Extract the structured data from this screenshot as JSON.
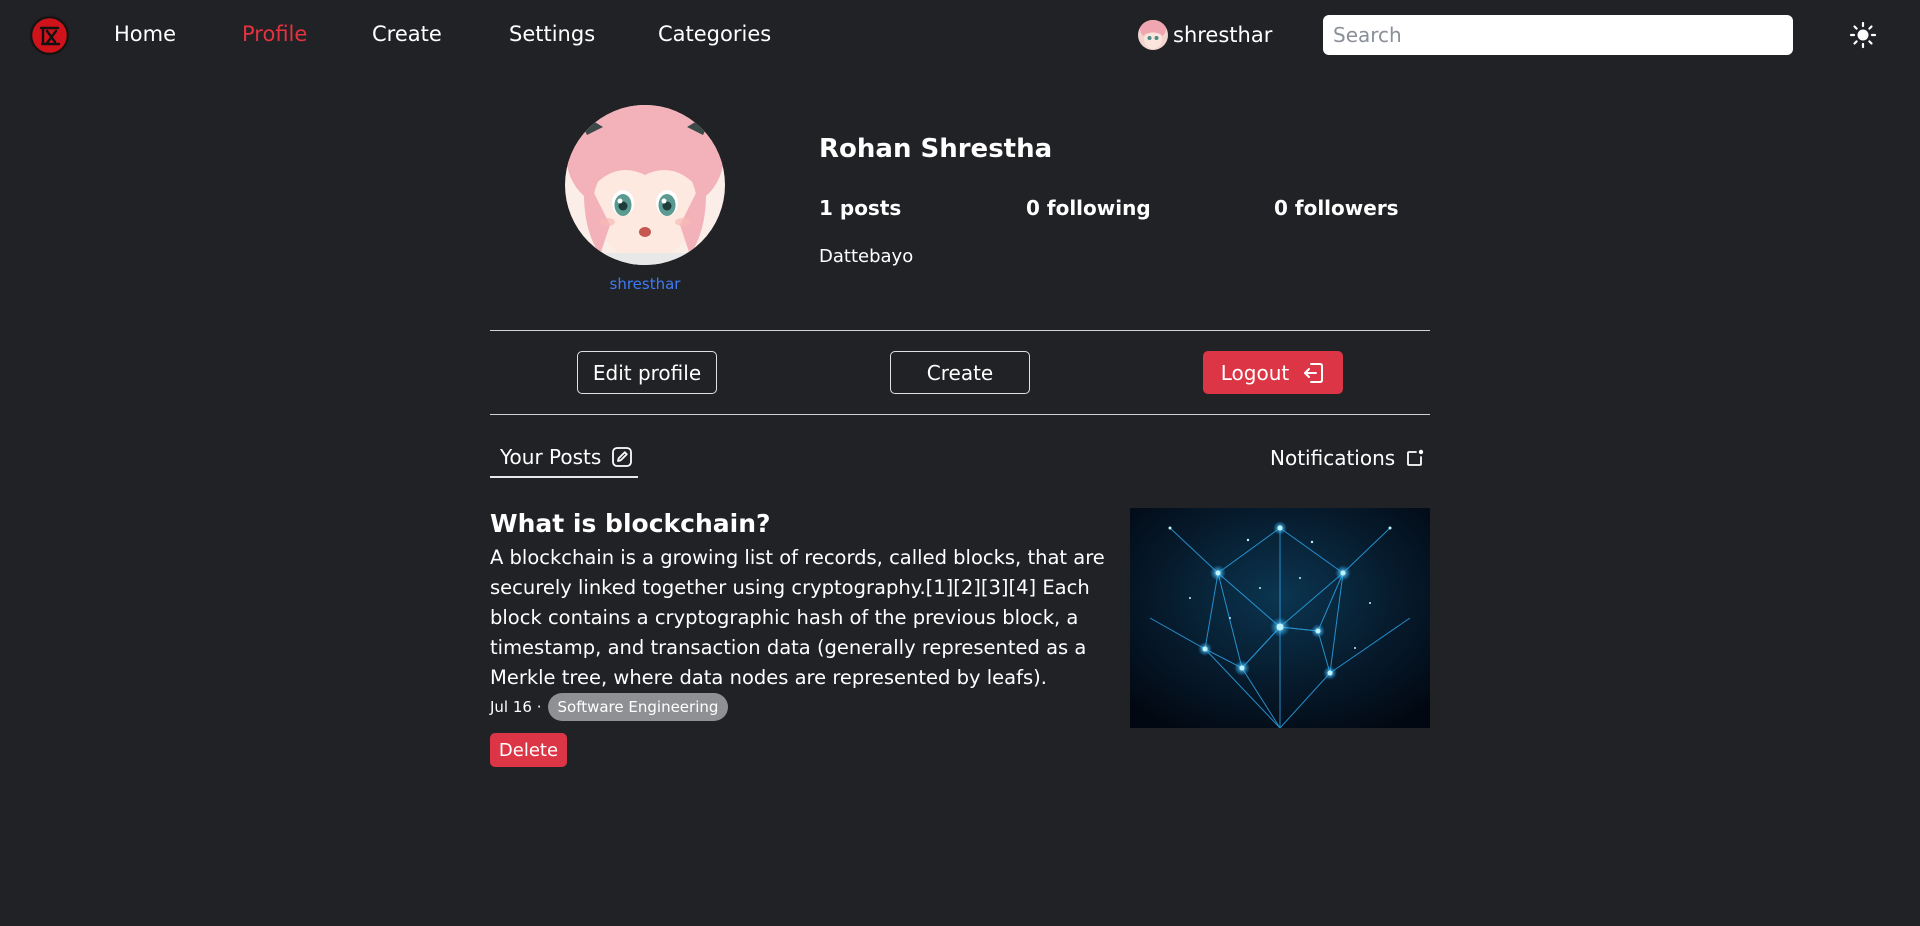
{
  "nav": {
    "logo_icon": "red-circle-logo-icon",
    "links": [
      "Home",
      "Profile",
      "Create",
      "Settings",
      "Categories"
    ],
    "active_link": "Profile",
    "username": "shresthar",
    "search_placeholder": "Search",
    "theme_icon": "sun-icon"
  },
  "profile": {
    "name": "Rohan Shrestha",
    "handle": "shresthar",
    "posts": "1 posts",
    "following": "0 following",
    "followers": "0 followers",
    "bio": "Dattebayo"
  },
  "actions": {
    "edit_label": "Edit profile",
    "create_label": "Create",
    "logout_label": "Logout",
    "logout_icon": "logout-icon"
  },
  "tabs": {
    "posts_label": "Your Posts",
    "posts_icon": "edit-icon",
    "notifications_label": "Notifications",
    "notifications_icon": "notification-icon"
  },
  "post": {
    "title": "What is blockchain?",
    "body": "A blockchain is a growing list of records, called blocks, that are securely linked together using cryptography.[1][2][3][4] Each block contains a cryptographic hash of the previous block, a timestamp, and transaction data (generally represented as a Merkle tree, where data nodes are represented by leafs).",
    "date": "Jul 16 ·",
    "tag": "Software Engineering",
    "delete_label": "Delete"
  },
  "colors": {
    "background": "#212226",
    "accent_red": "#dc3545",
    "active_link": "#e5323f",
    "handle_blue": "#3d7bf5",
    "tag_gray": "#8e9094"
  }
}
